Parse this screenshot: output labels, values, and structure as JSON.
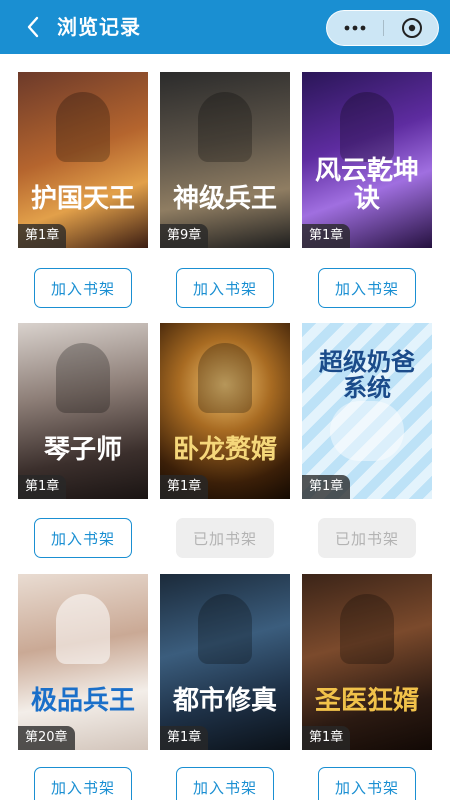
{
  "header": {
    "title": "浏览记录",
    "back_icon": "chevron-left-icon",
    "more_icon": "more-dots-icon",
    "close_icon": "close-circle-icon",
    "bg_color": "#1a8fd2"
  },
  "books": [
    {
      "cover_title": "护国天王",
      "chapter": "第1章",
      "button": "加入书架",
      "status": "add"
    },
    {
      "cover_title": "神级兵王",
      "chapter": "第9章",
      "button": "加入书架",
      "status": "add"
    },
    {
      "cover_title": "风云乾坤诀",
      "chapter": "第1章",
      "button": "加入书架",
      "status": "add"
    },
    {
      "cover_title": "琴子师",
      "chapter": "第1章",
      "button": "加入书架",
      "status": "add"
    },
    {
      "cover_title": "卧龙赘婿",
      "chapter": "第1章",
      "button": "已加书架",
      "status": "added"
    },
    {
      "cover_title": "超级奶爸系统",
      "chapter": "第1章",
      "button": "已加书架",
      "status": "added"
    },
    {
      "cover_title": "极品兵王",
      "chapter": "第20章",
      "button": "加入书架",
      "status": "add"
    },
    {
      "cover_title": "都市修真",
      "chapter": "第1章",
      "button": "加入书架",
      "status": "add"
    },
    {
      "cover_title": "圣医狂婿",
      "chapter": "第1章",
      "button": "加入书架",
      "status": "add"
    }
  ],
  "colors": {
    "accent": "#1a8fd2",
    "added_bg": "#eeeeee",
    "added_text": "#b3b3b3"
  }
}
